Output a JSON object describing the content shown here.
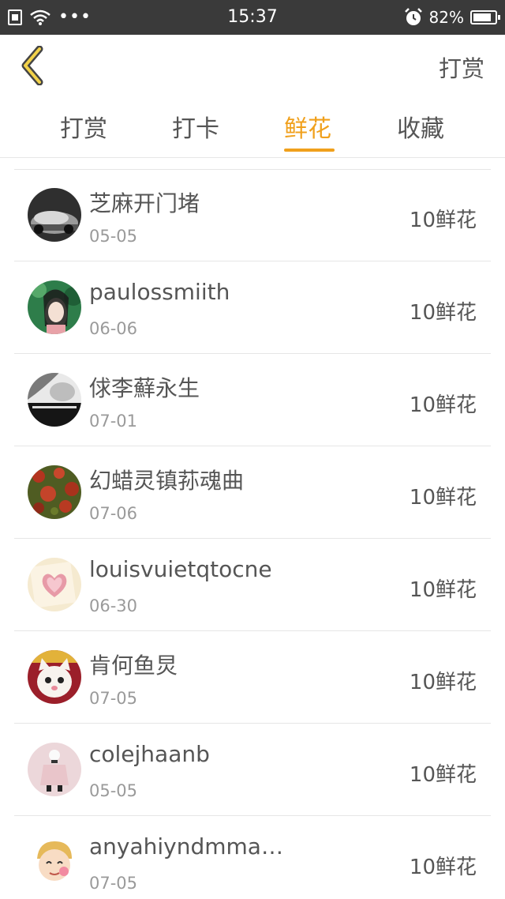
{
  "status_bar": {
    "time": "15:37",
    "battery": "82%",
    "more_dots": "•••"
  },
  "nav": {
    "action_label": "打赏"
  },
  "tabs": [
    {
      "label": "打赏",
      "active": false
    },
    {
      "label": "打卡",
      "active": false
    },
    {
      "label": "鲜花",
      "active": true
    },
    {
      "label": "收藏",
      "active": false
    }
  ],
  "list": [
    {
      "name": "芝麻开门堵",
      "date": "05-05",
      "amount": "10鲜花"
    },
    {
      "name": "paulossmiith",
      "date": "06-06",
      "amount": "10鲜花"
    },
    {
      "name": "俅李蘚永生",
      "date": "07-01",
      "amount": "10鲜花"
    },
    {
      "name": "幻蜡灵镇荪魂曲",
      "date": "07-06",
      "amount": "10鲜花"
    },
    {
      "name": "louisvuietqtocne",
      "date": "06-30",
      "amount": "10鲜花"
    },
    {
      "name": "肯何鱼炅",
      "date": "07-05",
      "amount": "10鲜花"
    },
    {
      "name": "colejhaanb",
      "date": "05-05",
      "amount": "10鲜花"
    },
    {
      "name": "anyahiyndmma…",
      "date": "07-05",
      "amount": "10鲜花"
    }
  ],
  "colors": {
    "accent": "#f0a01c",
    "status_bar_bg": "#3a3a3a",
    "text": "#555555",
    "subtext": "#9a9a9a",
    "divider": "#e6e6e6"
  }
}
